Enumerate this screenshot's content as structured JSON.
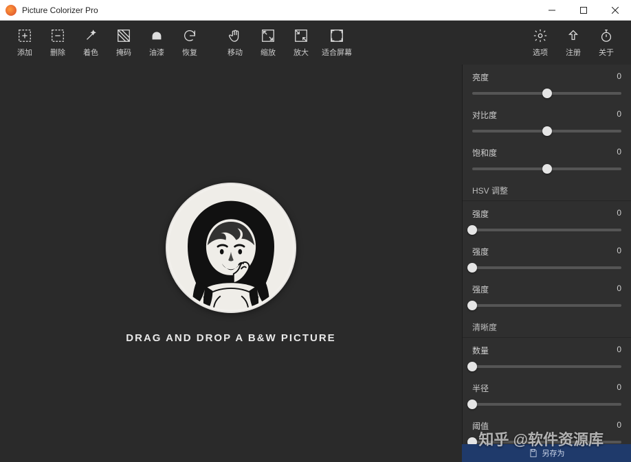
{
  "window": {
    "title": "Picture Colorizer Pro"
  },
  "toolbar": {
    "left": [
      {
        "id": "add",
        "label": "添加",
        "icon": "plus-box"
      },
      {
        "id": "delete",
        "label": "删除",
        "icon": "minus-box"
      },
      {
        "id": "color",
        "label": "着色",
        "icon": "wand"
      },
      {
        "id": "mask",
        "label": "掩码",
        "icon": "hatch"
      },
      {
        "id": "paint",
        "label": "油漆",
        "icon": "eraser"
      },
      {
        "id": "undo",
        "label": "恢复",
        "icon": "undo"
      },
      {
        "id": "move",
        "label": "移动",
        "icon": "hand"
      },
      {
        "id": "zoom",
        "label": "缩放",
        "icon": "expand"
      },
      {
        "id": "zoomin",
        "label": "放大",
        "icon": "collapse"
      },
      {
        "id": "fit",
        "label": "适合屏幕",
        "icon": "fit"
      }
    ],
    "right": [
      {
        "id": "options",
        "label": "选项",
        "icon": "gear"
      },
      {
        "id": "register",
        "label": "注册",
        "icon": "up"
      },
      {
        "id": "about",
        "label": "关于",
        "icon": "stopwatch"
      }
    ]
  },
  "canvas": {
    "drop_hint": "DRAG AND DROP A B&W PICTURE"
  },
  "panel": {
    "basic": [
      {
        "label": "亮度",
        "value": 0,
        "pos": 50
      },
      {
        "label": "对比度",
        "value": 0,
        "pos": 50
      },
      {
        "label": "饱和度",
        "value": 0,
        "pos": 50
      }
    ],
    "hsv_title": "HSV 调整",
    "hsv": [
      {
        "label": "强度",
        "value": 0,
        "pos": 0
      },
      {
        "label": "强度",
        "value": 0,
        "pos": 0
      },
      {
        "label": "强度",
        "value": 0,
        "pos": 0
      }
    ],
    "sharp_title": "清晰度",
    "sharp": [
      {
        "label": "数量",
        "value": 0,
        "pos": 0
      },
      {
        "label": "半径",
        "value": 0,
        "pos": 0
      },
      {
        "label": "阈值",
        "value": 0,
        "pos": 0
      }
    ]
  },
  "bottom": {
    "label": "另存为"
  },
  "watermark": {
    "text": "知乎 @软件资源库"
  }
}
